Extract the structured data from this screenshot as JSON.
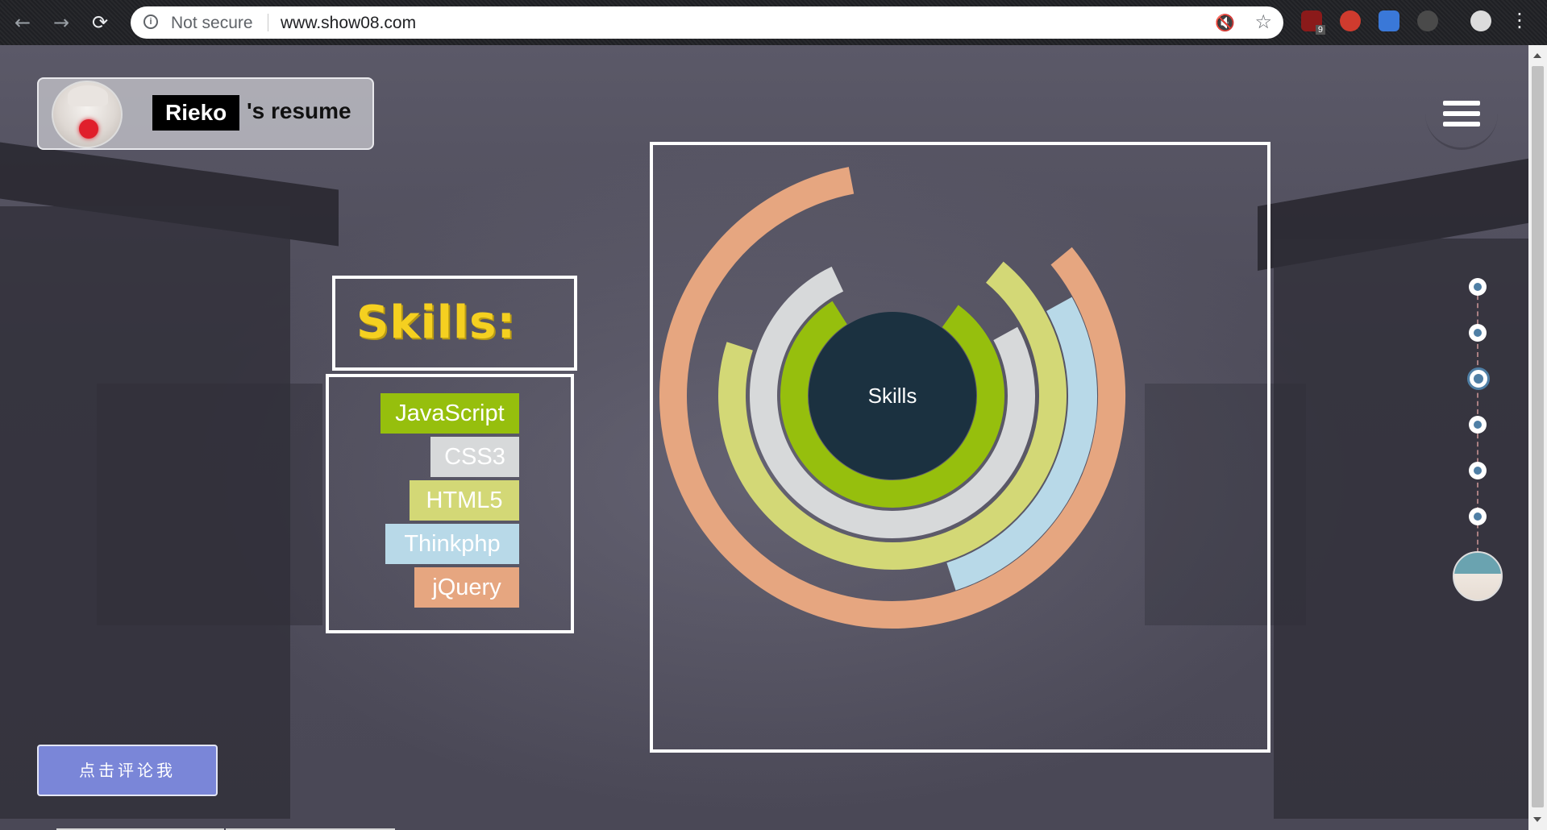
{
  "browser": {
    "security_label": "Not secure",
    "url": "www.show08.com",
    "extension_badge": "9"
  },
  "header": {
    "name": "Rieko",
    "suffix": "'s resume"
  },
  "skills": {
    "title": "Skills:",
    "items": [
      {
        "label": "JavaScript",
        "color": "#96bf0d"
      },
      {
        "label": "CSS3",
        "color": "#d7d9da"
      },
      {
        "label": "HTML5",
        "color": "#d3d876"
      },
      {
        "label": "Thinkphp",
        "color": "#b8d9e8"
      },
      {
        "label": "jQuery",
        "color": "#e6a680"
      }
    ]
  },
  "chart_data": {
    "type": "radial-bar",
    "center_label": "Skills",
    "center_color": "#1b3140",
    "series": [
      {
        "name": "JavaScript",
        "color": "#96bf0d",
        "fraction": 0.81
      },
      {
        "name": "CSS3",
        "color": "#d7d9da",
        "fraction": 0.76
      },
      {
        "name": "HTML5",
        "color": "#d3d876",
        "fraction": 0.69
      },
      {
        "name": "Thinkphp",
        "color": "#b8d9e8",
        "fraction": 0.28
      },
      {
        "name": "jQuery",
        "color": "#e6a680",
        "fraction": 0.83
      }
    ]
  },
  "side_nav": {
    "active_index": 2,
    "dot_count": 6
  },
  "comment_button": "点击评论我"
}
